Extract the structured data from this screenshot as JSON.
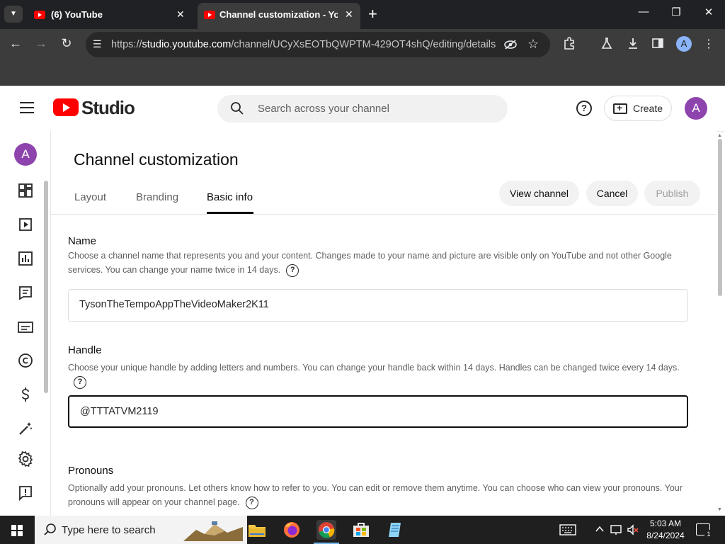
{
  "browser": {
    "tabs": [
      {
        "title": "(6) YouTube",
        "close": "✕"
      },
      {
        "title": "Channel customization - YouTube Studio",
        "close": "✕"
      }
    ],
    "new_tab": "+",
    "window_controls": {
      "minimize": "—",
      "restore": "❐",
      "close": "✕"
    },
    "url_host": "studio.youtube.com",
    "url_prefix": "https://",
    "url_path": "/channel/UCyXsEOTbQWPTM-429OT4shQ/editing/details",
    "profile_initial": "A",
    "icons": [
      "tab-list-icon",
      "back-icon",
      "forward-icon",
      "reload-icon",
      "site-info-icon",
      "eye-off-icon",
      "star-icon",
      "extensions-icon",
      "labs-icon",
      "download-icon",
      "side-panel-icon",
      "profile-icon",
      "more-vert-icon"
    ]
  },
  "header": {
    "logo_text": "Studio",
    "search_placeholder": "Search across your channel",
    "help": "?",
    "create_label": "Create",
    "avatar_initial": "A"
  },
  "sidebar": {
    "avatar_initial": "A",
    "items": [
      "dashboard-icon",
      "content-icon",
      "analytics-icon",
      "comments-icon",
      "subtitles-icon",
      "copyright-icon",
      "earn-icon",
      "customization-icon",
      "settings-icon",
      "feedback-icon"
    ]
  },
  "main": {
    "title": "Channel customization",
    "tabs": [
      {
        "label": "Layout",
        "active": false
      },
      {
        "label": "Branding",
        "active": false
      },
      {
        "label": "Basic info",
        "active": true
      }
    ],
    "actions": {
      "view_channel": "View channel",
      "cancel": "Cancel",
      "publish": "Publish"
    },
    "name": {
      "title": "Name",
      "desc": "Choose a channel name that represents you and your content. Changes made to your name and picture are visible only on YouTube and not other Google services. You can change your name twice in 14 days.",
      "value": "TysonTheTempoAppTheVideoMaker2K11"
    },
    "handle": {
      "title": "Handle",
      "desc": "Choose your unique handle by adding letters and numbers. You can change your handle back within 14 days. Handles can be changed twice every 14 days.",
      "value": "@TTTATVM2119"
    },
    "pronouns": {
      "title": "Pronouns",
      "desc": "Optionally add your pronouns. Let others know how to refer to you. You can edit or remove them anytime. You can choose who can view your pronouns. Your pronouns will appear on your channel page."
    },
    "help_glyph": "?"
  },
  "taskbar": {
    "search_text": "Type here to search",
    "time": "5:03 AM",
    "date": "8/24/2024",
    "notification_count": "1",
    "apps": [
      "file-explorer-icon",
      "firefox-icon",
      "chrome-icon",
      "store-icon",
      "notepad-icon"
    ]
  },
  "colors": {
    "brand_red": "#ff0000",
    "avatar_purple": "#8e44ad",
    "chrome_dark": "#3c3c3c",
    "taskbar": "#1f1f1f"
  }
}
